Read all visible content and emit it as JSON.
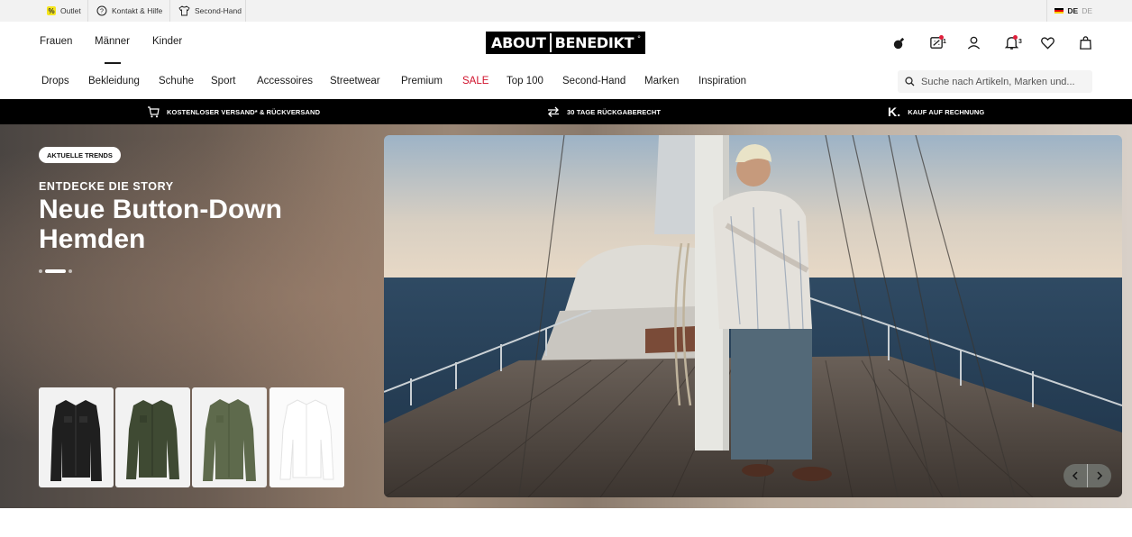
{
  "utility_bar": {
    "outlet": "Outlet",
    "contact": "Kontakt & Hilfe",
    "second_hand": "Second-Hand",
    "lang_current": "DE",
    "lang_alt": "DE"
  },
  "header": {
    "gender_nav": [
      "Frauen",
      "Männer",
      "Kinder"
    ],
    "active_gender": "Männer",
    "logo_left": "ABOUT",
    "logo_right": "BENEDIKT",
    "stories_count": "1",
    "notifications_count": "3"
  },
  "category_nav": {
    "items": [
      "Drops",
      "Bekleidung",
      "Schuhe",
      "Sport",
      "Accessoires",
      "Streetwear",
      "Premium",
      "SALE",
      "Top 100",
      "Second-Hand",
      "Marken",
      "Inspiration"
    ],
    "sale_color": "#d0112b"
  },
  "search": {
    "placeholder": "Suche nach Artikeln, Marken und..."
  },
  "usp_bar": {
    "shipping": "KOSTENLOSER VERSAND* & RÜCKVERSAND",
    "returns": "30 TAGE RÜCKGABERECHT",
    "invoice": "KAUF AUF RECHNUNG"
  },
  "hero": {
    "badge": "AKTUELLE TRENDS",
    "kicker": "ENTDECKE DIE STORY",
    "headline": "Neue Button-Down Hemden",
    "slides_total": 3,
    "slide_active": 2,
    "products": [
      {
        "icon": "shirt-black",
        "color": "#1f1f1f"
      },
      {
        "icon": "shirt-olive-dark",
        "color": "#3f4a33"
      },
      {
        "icon": "shirt-olive",
        "color": "#5e6a4c"
      },
      {
        "icon": "shirt-white",
        "color": "#fbfbfb"
      }
    ]
  },
  "colors": {
    "accent": "#000000",
    "sale": "#d0112b",
    "badge_dot": "#e0203c"
  }
}
